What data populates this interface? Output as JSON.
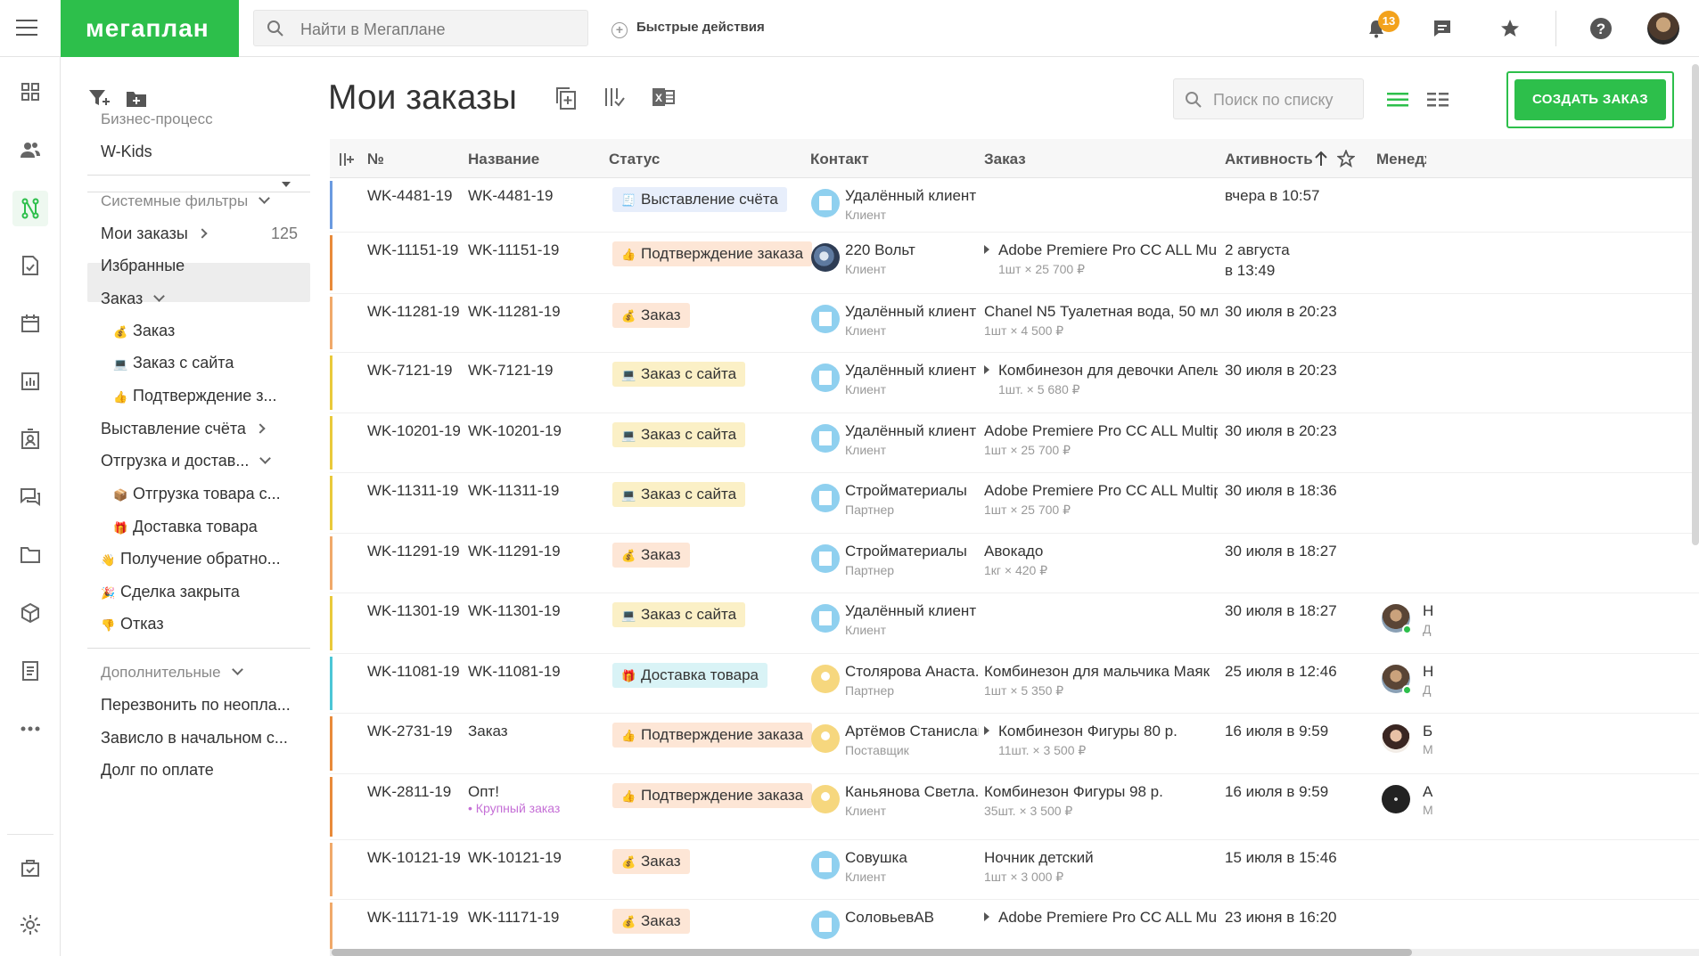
{
  "app": {
    "logo_text": "мегаплан",
    "brand_color": "#2dbf4b"
  },
  "topbar": {
    "search_placeholder": "Найти в Мегаплане",
    "quick_actions_label": "Быстрые действия",
    "notifications_count": "13"
  },
  "sidebar": {
    "bp_label": "Бизнес-процесс",
    "bp_value": "W-Kids",
    "system_filters_label": "Системные фильтры",
    "my_orders_label": "Мои заказы",
    "my_orders_count": "125",
    "favorites_label": "Избранные",
    "order_group_label": "Заказ",
    "order_item": "Заказ",
    "site_order_item": "Заказ с сайта",
    "confirm_item": "Подтверждение з...",
    "invoice_label": "Выставление счёта",
    "shipping_label": "Отгрузка и достав...",
    "shipment_item": "Отгрузка товара с...",
    "delivery_item": "Доставка товара",
    "return_item": "Получение обратно...",
    "closed_item": "Сделка закрыта",
    "reject_item": "Отказ",
    "extra_label": "Дополнительные",
    "extra_items": [
      "Перезвонить по неопла...",
      "Зависло в начальном с...",
      "Долг по оплате"
    ]
  },
  "main": {
    "title": "Мои заказы",
    "list_search_placeholder": "Поиск по списку",
    "create_button": "СОЗДАТЬ ЗАКАЗ"
  },
  "table": {
    "headers": {
      "num": "№",
      "name": "Название",
      "status": "Статус",
      "contact": "Контакт",
      "order": "Заказ",
      "activity": "Активность",
      "manager": "Менеджер"
    },
    "rows": [
      {
        "num": "WK-4481-19",
        "name": "WK-4481-19",
        "status": "Выставление счёта",
        "status_icon": "🧾",
        "status_bg": "#e7eefb",
        "bar": "#6a9ae0",
        "contact": "Удалённый клиент",
        "contact_role": "Клиент",
        "avatar": "company",
        "order": "",
        "order_sub": "",
        "order_arrow": false,
        "activity": "вчера в 10:57",
        "activity2": "",
        "manager": "",
        "manager_role": ""
      },
      {
        "num": "WK-11151-19",
        "name": "WK-11151-19",
        "status": "Подтверждение заказа",
        "status_icon": "👍",
        "status_bg": "#fde6d6",
        "bar": "#e88a3a",
        "contact": "220 Вольт",
        "contact_role": "Клиент",
        "avatar": "photo",
        "order": "Adobe Premiere Pro CC ALL Multipl...",
        "order_sub": "1шт × 25 700 ₽",
        "order_arrow": true,
        "activity": "2 августа",
        "activity2": "в 13:49",
        "manager": "",
        "manager_role": ""
      },
      {
        "num": "WK-11281-19",
        "name": "WK-11281-19",
        "status": "Заказ",
        "status_icon": "💰",
        "status_bg": "#fde6d6",
        "bar": "#f0a96a",
        "contact": "Удалённый клиент",
        "contact_role": "Клиент",
        "avatar": "company",
        "order": "Chanel N5 Туалетная вода, 50 мл",
        "order_sub": "1шт × 4 500 ₽",
        "order_arrow": false,
        "activity": "30 июля в 20:23",
        "activity2": "",
        "manager": "",
        "manager_role": ""
      },
      {
        "num": "WK-7121-19",
        "name": "WK-7121-19",
        "status": "Заказ с сайта",
        "status_icon": "💻",
        "status_bg": "#fbf0c6",
        "bar": "#e9c93b",
        "contact": "Удалённый клиент",
        "contact_role": "Клиент",
        "avatar": "company",
        "order": "Комбинезон для девочки Апельс...",
        "order_sub": "1шт. × 5 680 ₽",
        "order_arrow": true,
        "activity": "30 июля в 20:23",
        "activity2": "",
        "manager": "",
        "manager_role": ""
      },
      {
        "num": "WK-10201-19",
        "name": "WK-10201-19",
        "status": "Заказ с сайта",
        "status_icon": "💻",
        "status_bg": "#fbf0c6",
        "bar": "#e9c93b",
        "contact": "Удалённый клиент",
        "contact_role": "Клиент",
        "avatar": "company",
        "order": "Adobe Premiere Pro CC ALL Multiple ...",
        "order_sub": "1шт × 25 700 ₽",
        "order_arrow": false,
        "activity": "30 июля в 20:23",
        "activity2": "",
        "manager": "",
        "manager_role": ""
      },
      {
        "num": "WK-11311-19",
        "name": "WK-11311-19",
        "status": "Заказ с сайта",
        "status_icon": "💻",
        "status_bg": "#fbf0c6",
        "bar": "#e9c93b",
        "contact": "Стройматериалы",
        "contact_role": "Партнер",
        "avatar": "company",
        "order": "Adobe Premiere Pro CC ALL Multiple ...",
        "order_sub": "1шт × 25 700 ₽",
        "order_arrow": false,
        "activity": "30 июля в 18:36",
        "activity2": "",
        "manager": "",
        "manager_role": ""
      },
      {
        "num": "WK-11291-19",
        "name": "WK-11291-19",
        "status": "Заказ",
        "status_icon": "💰",
        "status_bg": "#fde6d6",
        "bar": "#f0a96a",
        "contact": "Стройматериалы",
        "contact_role": "Партнер",
        "avatar": "company",
        "order": "Авокадо",
        "order_sub": "1кг × 420 ₽",
        "order_arrow": false,
        "activity": "30 июля в 18:27",
        "activity2": "",
        "manager": "",
        "manager_role": ""
      },
      {
        "num": "WK-11301-19",
        "name": "WK-11301-19",
        "status": "Заказ с сайта",
        "status_icon": "💻",
        "status_bg": "#fbf0c6",
        "bar": "#e9c93b",
        "contact": "Удалённый клиент",
        "contact_role": "Клиент",
        "avatar": "company",
        "order": "",
        "order_sub": "",
        "order_arrow": false,
        "activity": "30 июля в 18:27",
        "activity2": "",
        "manager": "Н",
        "manager_role": "Д"
      },
      {
        "num": "WK-11081-19",
        "name": "WK-11081-19",
        "status": "Доставка товара",
        "status_icon": "🎁",
        "status_bg": "#d9f3f6",
        "bar": "#4cc6d6",
        "contact": "Столярова Анаста...",
        "contact_role": "Партнер",
        "avatar": "person",
        "order": "Комбинезон для мальчика Маяк",
        "order_sub": "1шт × 5 350 ₽",
        "order_arrow": false,
        "activity": "25 июля в 12:46",
        "activity2": "",
        "manager": "Н",
        "manager_role": "Д"
      },
      {
        "num": "WK-2731-19",
        "name": "Заказ",
        "status": "Подтверждение заказа",
        "status_icon": "👍",
        "status_bg": "#fde6d6",
        "bar": "#e88a3a",
        "contact": "Артёмов Станислав",
        "contact_role": "Поставщик",
        "avatar": "person",
        "order": "Комбинезон Фигуры 80 р.",
        "order_sub": "11шт. × 3 500 ₽",
        "order_arrow": true,
        "activity": "16 июля в 9:59",
        "activity2": "",
        "manager": "Б",
        "manager_role": "М"
      },
      {
        "num": "WK-2811-19",
        "name": "Опт!",
        "name_tag": "• Крупный заказ",
        "status": "Подтверждение заказа",
        "status_icon": "👍",
        "status_bg": "#fde6d6",
        "bar": "#e88a3a",
        "contact": "Каньянова Светла...",
        "contact_role": "Клиент",
        "avatar": "person",
        "order": "Комбинезон Фигуры 98 р.",
        "order_sub": "35шт. × 3 500 ₽",
        "order_arrow": false,
        "activity": "16 июля в 9:59",
        "activity2": "",
        "manager": "А",
        "manager_role": "М"
      },
      {
        "num": "WK-10121-19",
        "name": "WK-10121-19",
        "status": "Заказ",
        "status_icon": "💰",
        "status_bg": "#fde6d6",
        "bar": "#f0a96a",
        "contact": "Совушка",
        "contact_role": "Клиент",
        "avatar": "company",
        "order": "Ночник детский",
        "order_sub": "1шт × 3 000 ₽",
        "order_arrow": false,
        "activity": "15 июля в 15:46",
        "activity2": "",
        "manager": "",
        "manager_role": ""
      },
      {
        "num": "WK-11171-19",
        "name": "WK-11171-19",
        "status": "Заказ",
        "status_icon": "💰",
        "status_bg": "#fde6d6",
        "bar": "#f0a96a",
        "contact": "СоловьевАВ",
        "contact_role": "",
        "avatar": "company",
        "order": "Adobe Premiere Pro CC ALL Multipl...",
        "order_sub": "",
        "order_arrow": true,
        "activity": "23 июня в 16:20",
        "activity2": "",
        "manager": "",
        "manager_role": ""
      }
    ]
  }
}
